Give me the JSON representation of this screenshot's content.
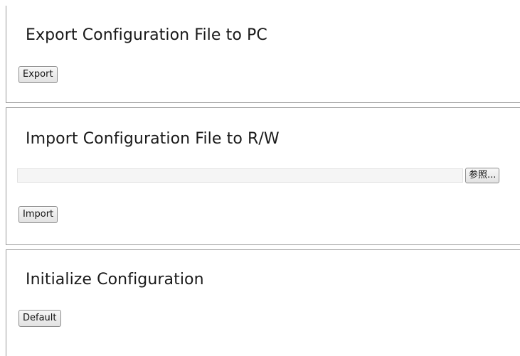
{
  "export_section": {
    "title": "Export Configuration File to PC",
    "button_label": "Export"
  },
  "import_section": {
    "title": "Import Configuration File to R/W",
    "file_path_value": "",
    "browse_label": "参照...",
    "button_label": "Import"
  },
  "init_section": {
    "title": "Initialize Configuration",
    "button_label": "Default"
  },
  "colors": {
    "panel_border": "#9a9a9a",
    "heading_text": "#1a1a1a",
    "file_field_bg": "#f5f5f5"
  }
}
